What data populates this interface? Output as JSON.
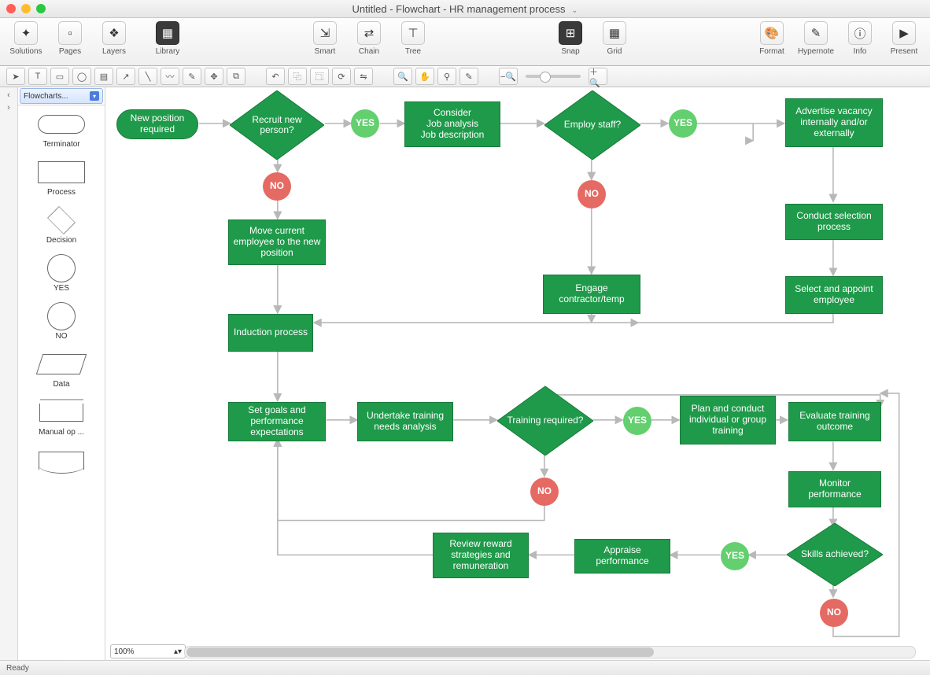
{
  "window": {
    "title": "Untitled - Flowchart - HR management process"
  },
  "toolbar": {
    "solutions": "Solutions",
    "pages": "Pages",
    "layers": "Layers",
    "library": "Library",
    "smart": "Smart",
    "chain": "Chain",
    "tree": "Tree",
    "snap": "Snap",
    "grid": "Grid",
    "format": "Format",
    "hypernote": "Hypernote",
    "info": "Info",
    "present": "Present"
  },
  "library": {
    "selector": "Flowcharts...",
    "shapes": [
      {
        "label": "Terminator"
      },
      {
        "label": "Process"
      },
      {
        "label": "Decision"
      },
      {
        "label": "YES"
      },
      {
        "label": "NO"
      },
      {
        "label": "Data"
      },
      {
        "label": "Manual op ..."
      },
      {
        "label": ""
      }
    ]
  },
  "canvas": {
    "zoom": "100%"
  },
  "status": {
    "text": "Ready"
  },
  "flow": {
    "start": "New position required",
    "d_recruit": "Recruit new person?",
    "consider": "Consider\nJob analysis\nJob description",
    "d_employ": "Employ staff?",
    "advertise": "Advertise vacancy internally and/or externally",
    "conduct": "Conduct selection process",
    "select": "Select and appoint employee",
    "move": "Move current employee to the new position",
    "engage": "Engage contractor/temp",
    "induction": "Induction process",
    "setgoals": "Set goals and performance expectations",
    "undertake": "Undertake training needs analysis",
    "d_training": "Training required?",
    "plan": "Plan and conduct individual or group training",
    "evaluate": "Evaluate training outcome",
    "monitor": "Monitor performance",
    "d_skills": "Skills achieved?",
    "appraise": "Appraise performance",
    "review": "Review reward strategies and remuneration",
    "yes": "YES",
    "no": "NO"
  }
}
